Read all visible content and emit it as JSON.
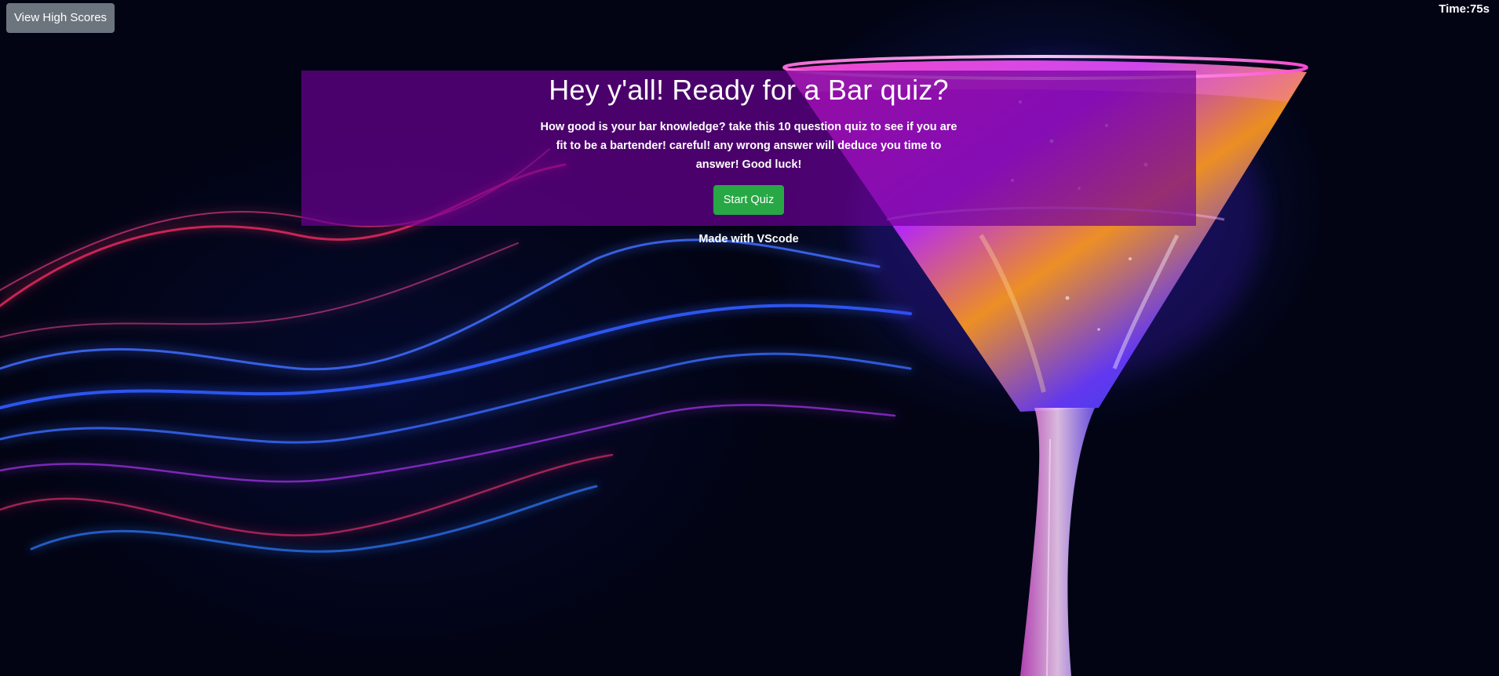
{
  "header": {
    "high_scores_label": "View High Scores",
    "timer_label": "Time:",
    "timer_value": "75s"
  },
  "intro": {
    "title": "Hey y'all! Ready for a Bar quiz?",
    "description": "How good is your bar knowledge? take this 10 question quiz to see if you are fit to be a bartender! careful! any wrong answer will deduce you time to answer! Good luck!",
    "start_label": "Start Quiz"
  },
  "footer": {
    "text": "Made with VScode"
  },
  "colors": {
    "card_background": "#6e0096",
    "start_button": "#28a745",
    "high_scores_button": "#6c757d",
    "page_background": "#020414"
  },
  "background_image": "martini-glass-neon-light-waves"
}
